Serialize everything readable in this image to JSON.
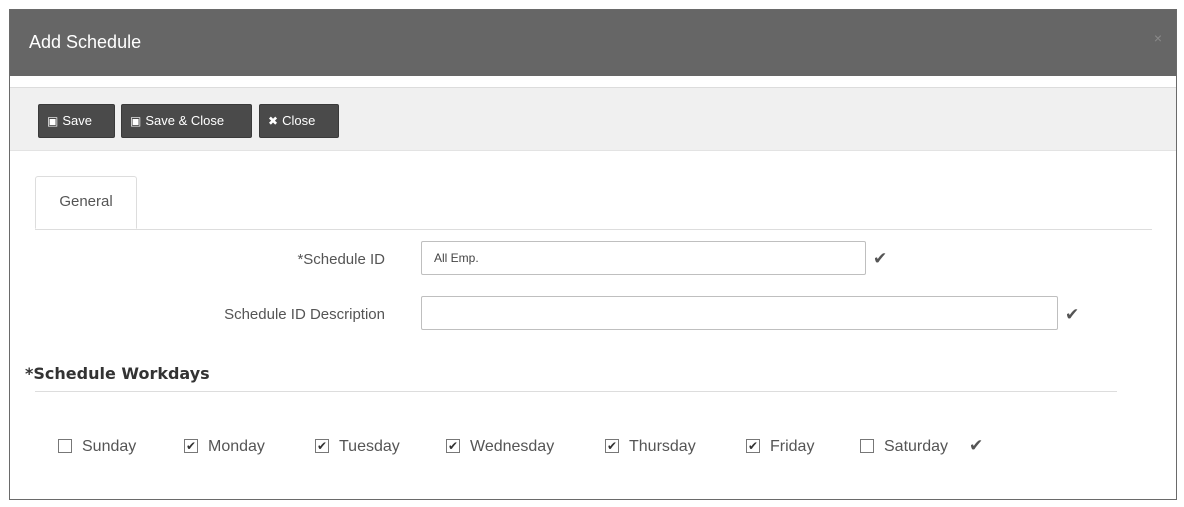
{
  "dialog": {
    "title": "Add Schedule",
    "close_glyph": "×"
  },
  "toolbar": {
    "save_label": "Save",
    "save_close_label": "Save & Close",
    "close_label": "Close"
  },
  "tabs": [
    {
      "label": "General",
      "active": true
    }
  ],
  "form": {
    "schedule_id": {
      "label": "*Schedule ID",
      "value": "All Emp."
    },
    "schedule_description": {
      "label": "Schedule ID Description",
      "value": ""
    }
  },
  "workdays": {
    "title": "*Schedule Workdays",
    "days": [
      {
        "label": "Sunday",
        "checked": false
      },
      {
        "label": "Monday",
        "checked": true
      },
      {
        "label": "Tuesday",
        "checked": true
      },
      {
        "label": "Wednesday",
        "checked": true
      },
      {
        "label": "Thursday",
        "checked": true
      },
      {
        "label": "Friday",
        "checked": true
      },
      {
        "label": "Saturday",
        "checked": false
      }
    ]
  },
  "icons": {
    "check": "✔",
    "box_checked": "✔",
    "save_icon": "save-icon",
    "save_close_icon": "save-close-icon",
    "close_icon": "close-icon"
  },
  "colors": {
    "titlebar": "#666666",
    "button": "#4a4a4a",
    "toolbar": "#f0f0f0"
  }
}
